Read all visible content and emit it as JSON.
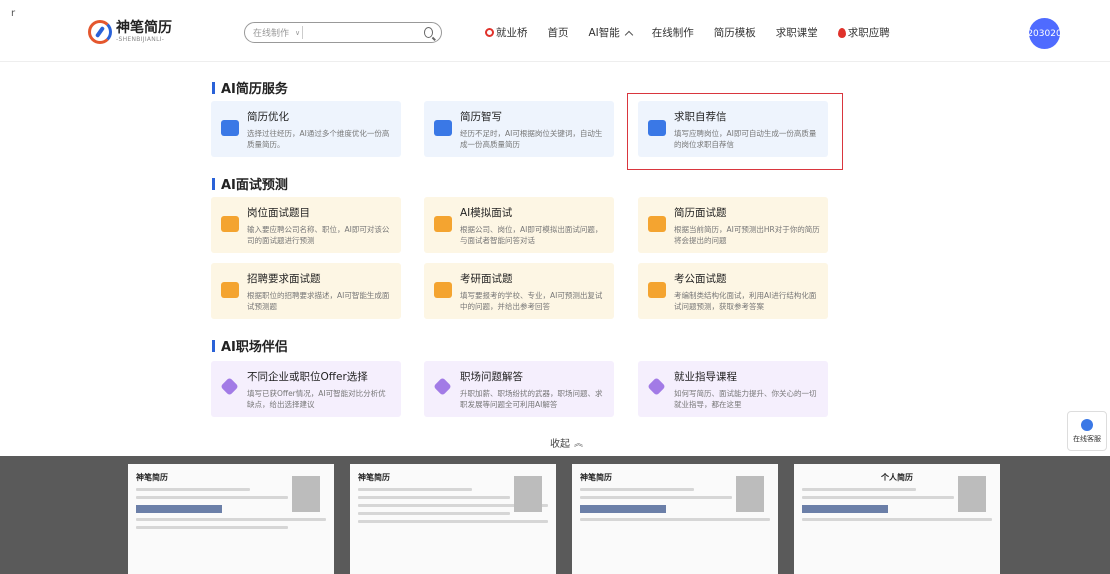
{
  "header": {
    "corner_mark": "r",
    "logo_cn": "神笔简历",
    "logo_en": "-SHENBIJIANLI-",
    "search_select": "在线制作",
    "search_placeholder": "",
    "nav": [
      {
        "label": "就业桥"
      },
      {
        "label": "首页"
      },
      {
        "label": "AI智能"
      },
      {
        "label": "在线制作"
      },
      {
        "label": "简历模板"
      },
      {
        "label": "求职课堂"
      },
      {
        "label": "求职应聘"
      }
    ],
    "avatar_text": "203020"
  },
  "sections": [
    {
      "title": "AI简历服务",
      "cards": [
        {
          "title": "简历优化",
          "desc": "选择过往经历，AI通过多个维度优化一份高质量简历。",
          "color": "blue",
          "icon": "resume-optimize-icon"
        },
        {
          "title": "简历智写",
          "desc": "经历不足时，AI可根据岗位关键词，自动生成一份高质量简历",
          "color": "blue",
          "icon": "resume-write-icon"
        },
        {
          "title": "求职自荐信",
          "desc": "填写应聘岗位，AI即可自动生成一份高质量的岗位求职自荐信",
          "color": "blue",
          "icon": "cover-letter-icon"
        }
      ]
    },
    {
      "title": "AI面试预测",
      "cards": [
        {
          "title": "岗位面试题目",
          "desc": "输入要应聘公司名称、职位，AI即可对该公司的面试题进行预测",
          "color": "yellow",
          "icon": "position-question-icon"
        },
        {
          "title": "AI模拟面试",
          "desc": "根据公司、岗位，AI即可模拟出面试问题，与面试者智能问答对话",
          "color": "yellow",
          "icon": "mock-interview-icon"
        },
        {
          "title": "简历面试题",
          "desc": "根据当前简历，AI可预测出HR对于你的简历将会提出的问题",
          "color": "yellow",
          "icon": "resume-question-icon"
        },
        {
          "title": "招聘要求面试题",
          "desc": "根据职位的招聘要求描述，AI可智能生成面试预测题",
          "color": "yellow",
          "icon": "requirement-question-icon"
        },
        {
          "title": "考研面试题",
          "desc": "填写要报考的学校、专业，AI可预测出复试中的问题，并给出参考回答",
          "color": "yellow",
          "icon": "postgrad-question-icon"
        },
        {
          "title": "考公面试题",
          "desc": "考编制类结构化面试，利用AI进行结构化面试问题预测，获取参考答案",
          "color": "yellow",
          "icon": "civil-service-question-icon"
        }
      ]
    },
    {
      "title": "AI职场伴侣",
      "cards": [
        {
          "title": "不同企业或职位Offer选择",
          "desc": "填写已获Offer情况，AI可智能对比分析优缺点，给出选择建议",
          "color": "purple",
          "icon": "offer-compare-icon"
        },
        {
          "title": "职场问题解答",
          "desc": "升职加薪、职场纷扰的武器，职场问题、求职发展等问题全可利用AI解答",
          "color": "purple",
          "icon": "workplace-qa-icon"
        },
        {
          "title": "就业指导课程",
          "desc": "如何写简历、面试能力提升、你关心的一切就业指导，都在这里",
          "color": "purple",
          "icon": "career-course-icon"
        }
      ]
    }
  ],
  "collapse_label": "收起",
  "side_service_label": "在线客服",
  "resume_thumbs": [
    {
      "name": "神笔简历"
    },
    {
      "name": "神笔简历"
    },
    {
      "name": "神笔简历"
    },
    {
      "name": "个人简历"
    }
  ]
}
